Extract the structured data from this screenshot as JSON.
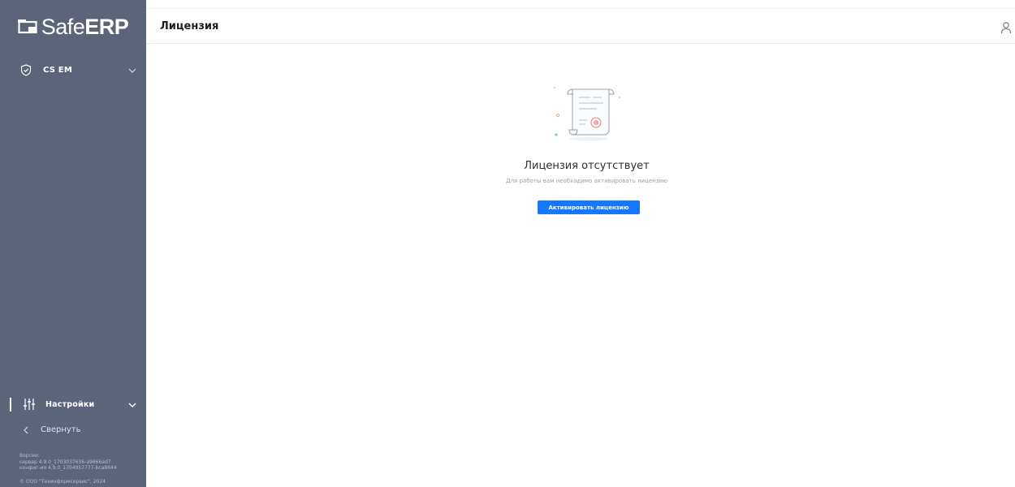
{
  "app": {
    "logo": {
      "part1": "Safe",
      "part2": "ERP"
    }
  },
  "header": {
    "title": "Лицензия"
  },
  "sidebar": {
    "items": [
      {
        "label": "CS EM",
        "icon": "shield-check-icon"
      }
    ],
    "settings": {
      "label": "Настройки",
      "icon": "sliders-icon"
    },
    "collapse_label": "Свернуть",
    "version": {
      "heading": "Версии:",
      "server": "сервер 4.9.0_1703037636-a9666ad7",
      "config": "конфиг-ия 4.9.0_1704957777-bca8644"
    },
    "copyright": "© ООО \"Техинформсервис\", 2024"
  },
  "main": {
    "empty_title": "Лицензия отсутствует",
    "empty_subtitle": "Для работы вам необходимо активировать лицензию",
    "activate_button": "Активировать лицензию"
  },
  "colors": {
    "sidebar_bg": "#5b6478",
    "primary": "#1677ff",
    "accent_red": "#f07a7a",
    "accent_green": "#62c46a"
  }
}
